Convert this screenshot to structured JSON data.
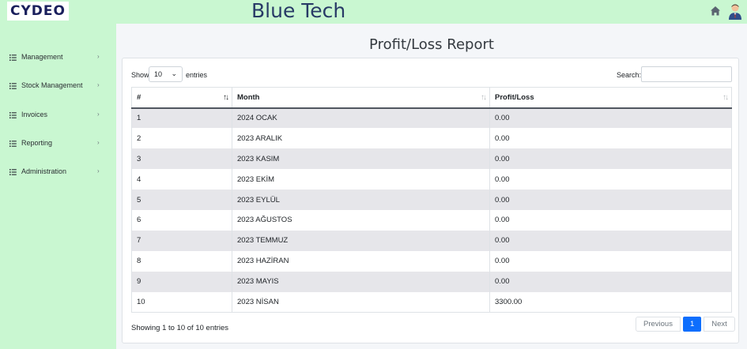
{
  "header": {
    "logo_text": "CYDEO",
    "brand": "Blue Tech",
    "home_icon": "home-icon",
    "avatar_icon": "user-avatar-icon"
  },
  "sidebar": {
    "items": [
      {
        "label": "Management",
        "icon": "list-icon"
      },
      {
        "label": "Stock Management",
        "icon": "list-icon"
      },
      {
        "label": "Invoices",
        "icon": "list-icon"
      },
      {
        "label": "Reporting",
        "icon": "list-icon"
      },
      {
        "label": "Administration",
        "icon": "list-icon"
      }
    ]
  },
  "page": {
    "title": "Profit/Loss Report"
  },
  "table_controls": {
    "show_label": "Show",
    "page_size": "10",
    "entries_label": "entries",
    "search_label": "Search:",
    "search_value": ""
  },
  "table": {
    "columns": [
      "#",
      "Month",
      "Profit/Loss"
    ],
    "rows": [
      [
        "1",
        "2024 OCAK",
        "0.00"
      ],
      [
        "2",
        "2023 ARALIK",
        "0.00"
      ],
      [
        "3",
        "2023 KASIM",
        "0.00"
      ],
      [
        "4",
        "2023 EKİM",
        "0.00"
      ],
      [
        "5",
        "2023 EYLÜL",
        "0.00"
      ],
      [
        "6",
        "2023 AĞUSTOS",
        "0.00"
      ],
      [
        "7",
        "2023 TEMMUZ",
        "0.00"
      ],
      [
        "8",
        "2023 HAZİRAN",
        "0.00"
      ],
      [
        "9",
        "2023 MAYIS",
        "0.00"
      ],
      [
        "10",
        "2023 NİSAN",
        "3300.00"
      ]
    ]
  },
  "footer": {
    "info": "Showing 1 to 10 of 10 entries",
    "previous": "Previous",
    "current_page": "1",
    "next": "Next"
  },
  "colors": {
    "sidebar_bg": "#c9f7d1",
    "accent": "#0d6efd",
    "brand_text": "#283a66"
  }
}
